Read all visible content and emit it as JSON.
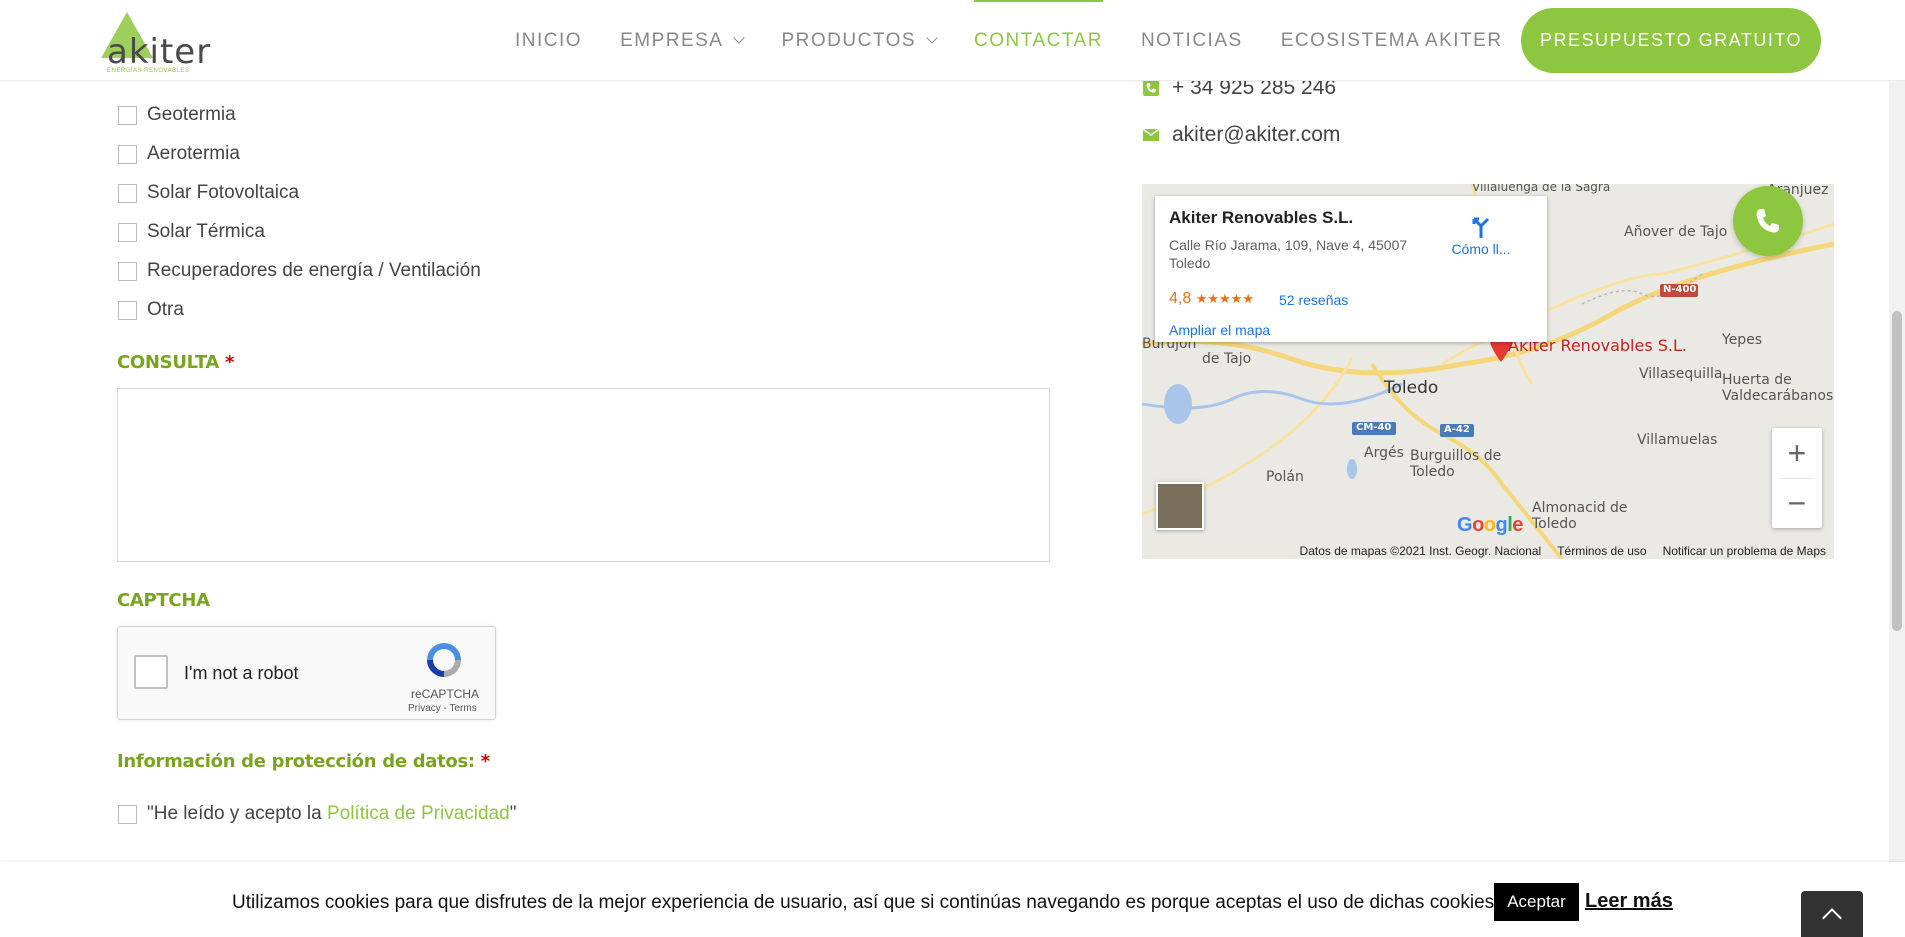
{
  "header": {
    "logo_text": "akiter",
    "logo_sub": "ENERGÍAS RENOVABLES",
    "nav": [
      {
        "label": "INICIO"
      },
      {
        "label": "EMPRESA"
      },
      {
        "label": "PRODUCTOS"
      },
      {
        "label": "CONTACTAR"
      },
      {
        "label": "NOTICIAS"
      },
      {
        "label": "ECOSISTEMA AKITER"
      }
    ],
    "cta_label": "PRESUPUESTO GRATUITO"
  },
  "form": {
    "options": [
      {
        "label": "Geotermia"
      },
      {
        "label": "Aerotermia"
      },
      {
        "label": "Solar Fotovoltaica"
      },
      {
        "label": "Solar Térmica"
      },
      {
        "label": "Recuperadores de energía / Ventilación"
      },
      {
        "label": "Otra"
      }
    ],
    "consulta_label": "CONSULTA",
    "required_mark": "*",
    "captcha_label": "CAPTCHA",
    "recaptcha": {
      "checkbox_label": "I'm not a robot",
      "brand": "reCAPTCHA",
      "links": "Privacy - Terms"
    },
    "privacy_label": "Información de protección de datos:",
    "privacy_text_prefix": "\"He leído y acepto la ",
    "privacy_link": "Política de Privacidad",
    "privacy_text_suffix": "\""
  },
  "contact": {
    "phone": "+ 34 925 285 246",
    "email": "akiter@akiter.com"
  },
  "map": {
    "business_name": "Akiter Renovables S.L.",
    "address": "Calle Río Jarama, 109, Nave 4, 45007 Toledo",
    "directions_label": "Cómo ll...",
    "rating": "4,8",
    "stars": "★★★★★",
    "reviews": "52 reseñas",
    "expand_label": "Ampliar el mapa",
    "pin_label": "Akiter Renovables S.L.",
    "places": [
      "Toledo",
      "Argés",
      "Polán",
      "Burguillos de Toledo",
      "Almonacid de Toledo",
      "Villamuelas",
      "Villasequilla",
      "Yepes",
      "Huerta de Valdecarábanos",
      "Añover de Tajo",
      "Aranjuez",
      "Burujón",
      "de Tajo",
      "Villaluenga de la Sagra"
    ],
    "road_labels": [
      "CM-40",
      "A-42",
      "N-400"
    ],
    "zoom_in": "+",
    "zoom_out": "−",
    "google": "Google",
    "attribution": {
      "data": "Datos de mapas ©2021 Inst. Geogr. Nacional",
      "terms": "Términos de uso",
      "report": "Notificar un problema de Maps"
    }
  },
  "cookie": {
    "message": "Utilizamos cookies para que disfrutes de la mejor experiencia de usuario, así que si continúas navegando es porque aceptas el uso de dichas cookies.",
    "accept_label": "Aceptar",
    "more_label": "Leer más"
  },
  "colors": {
    "accent": "#8dc63f",
    "label_green": "#7aa41f",
    "required": "#cc0000"
  }
}
